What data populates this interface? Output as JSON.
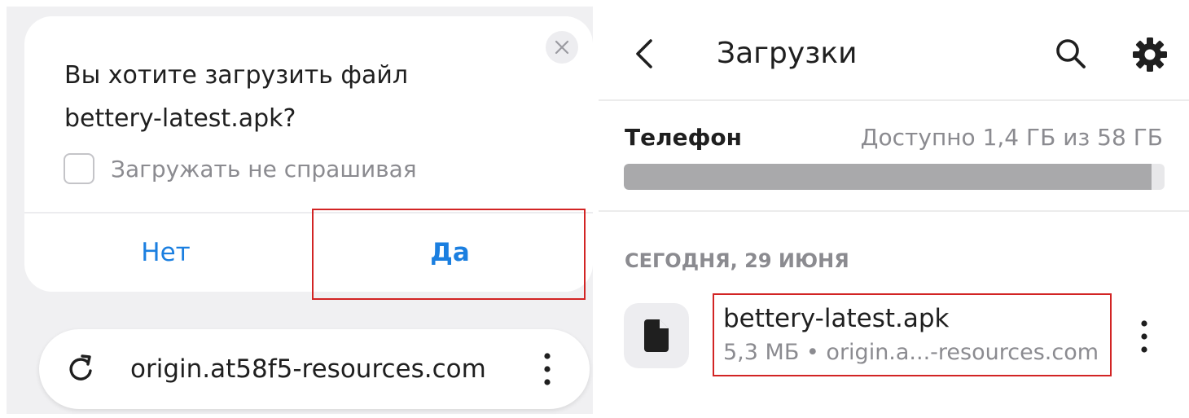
{
  "dialog": {
    "question_line1": "Вы хотите загрузить файл",
    "question_line2": "bettery-latest.apk?",
    "checkbox_label": "Загружать не спрашивая",
    "checkbox_checked": false,
    "no_label": "Нет",
    "yes_label": "Да",
    "close_icon": "close-icon"
  },
  "urlbar": {
    "url": "origin.at58f5-resources.com",
    "reload_icon": "reload-icon",
    "menu_icon": "more-vertical-icon"
  },
  "downloads": {
    "title": "Загрузки",
    "back_icon": "chevron-left-icon",
    "search_icon": "search-icon",
    "settings_icon": "gear-icon",
    "storage": {
      "label": "Телефон",
      "available": "Доступно 1,4 ГБ из 58 ГБ",
      "used_fraction": 0.976
    },
    "date_header": "СЕГОДНЯ, 29 ИЮНЯ",
    "files": [
      {
        "name": "bettery-latest.apk",
        "meta": "5,3 МБ • origin.a...-resources.com",
        "icon": "file-icon",
        "menu_icon": "more-vertical-icon"
      }
    ]
  },
  "colors": {
    "accent": "#1b7fe0",
    "highlight": "#d22424",
    "muted_text": "#8b8b90",
    "panel_bg": "#f0f0f2"
  }
}
